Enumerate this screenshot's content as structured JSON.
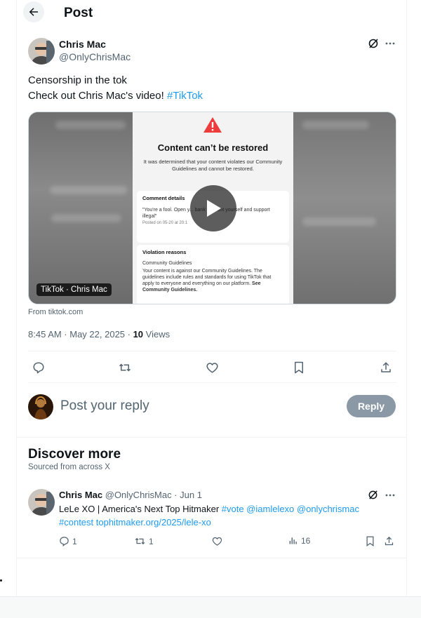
{
  "header": {
    "title": "Post"
  },
  "post": {
    "author_name": "Chris Mac",
    "author_handle": "@OnlyChrisMac",
    "text_line1": "Censorship in the tok",
    "text_line2_prefix": "Check out Chris Mac's video! ",
    "hashtag": "#TikTok",
    "media": {
      "title": "Content can’t be restored",
      "description": "It was determined that your content violates our Community Guidelines and cannot be restored.",
      "comment_header": "Comment details",
      "comment_text": "\"You're a fool. Open y... bank account yourself and support illegal\"",
      "comment_date": "Posted on 05-20 at 20:1",
      "violation_header": "Violation reasons",
      "violation_sub": "Community Guidelines",
      "violation_text": "Your content is against our Community Guidelines. The guidelines include rules and standards for using TikTok that apply to everyone and everything on our platform.",
      "violation_link": "See Community Guidelines.",
      "badge": "TikTok · Chris Mac"
    },
    "source": "From tiktok.com",
    "time": "8:45 AM · May 22, 2025 · ",
    "views_count": "10",
    "views_label": " Views"
  },
  "reply": {
    "placeholder": "Post your reply",
    "button": "Reply"
  },
  "discover": {
    "title": "Discover more",
    "subtitle": "Sourced from across X",
    "item": {
      "author_name": "Chris Mac",
      "meta": " @OnlyChrisMac · Jun 1",
      "text_plain": "LeLe XO | America's Next Top Hitmaker ",
      "links1": "#vote @iamlelexo @onlychrismac",
      "links2": "#contest  tophitmaker.org/2025/lele-xo",
      "replies": "1",
      "reposts": "1",
      "views": "16"
    }
  },
  "colors": {
    "accent": "#1d9bf0",
    "muted": "#536471",
    "reply_button": "#8b98a5"
  },
  "icons": [
    "back-arrow-icon",
    "grok-icon",
    "more-icon",
    "warning-icon",
    "play-icon",
    "reply-icon",
    "repost-icon",
    "like-icon",
    "bookmark-icon",
    "share-icon",
    "views-icon"
  ]
}
